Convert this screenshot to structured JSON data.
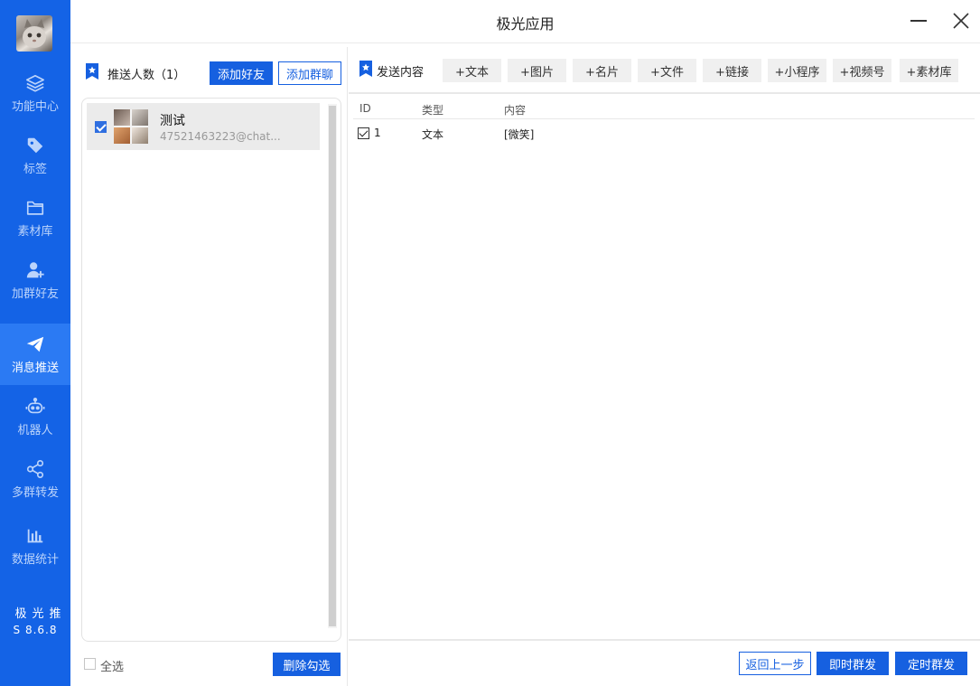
{
  "window": {
    "title": "极光应用"
  },
  "sidebar": {
    "items": [
      {
        "label": "功能中心",
        "icon": "layers-icon"
      },
      {
        "label": "标签",
        "icon": "tag-icon"
      },
      {
        "label": "素材库",
        "icon": "folder-icon"
      },
      {
        "label": "加群好友",
        "icon": "user-add-icon"
      },
      {
        "label": "消息推送",
        "icon": "send-icon",
        "active": true
      },
      {
        "label": "机器人",
        "icon": "robot-icon"
      },
      {
        "label": "多群转发",
        "icon": "share-icon"
      },
      {
        "label": "数据统计",
        "icon": "bar-chart-icon"
      }
    ],
    "brand_name": "极光推",
    "version": "S 8.6.8"
  },
  "left_panel": {
    "title": "推送人数（1）",
    "add_friend_button": "添加好友",
    "add_group_button": "添加群聊",
    "contacts": [
      {
        "name": "测试",
        "id": "47521463223@chat...",
        "checked": true
      }
    ],
    "select_all_label": "全选",
    "delete_selected_button": "删除勾选"
  },
  "right_panel": {
    "title": "发送内容",
    "add_buttons": [
      "+文本",
      "+图片",
      "+名片",
      "+文件",
      "+链接",
      "+小程序",
      "+视频号",
      "+素材库"
    ],
    "table": {
      "headers": [
        "ID",
        "类型",
        "内容"
      ],
      "rows": [
        {
          "id": "1",
          "type": "文本",
          "content": "[微笑]",
          "checked": true
        }
      ]
    },
    "back_button": "返回上一步",
    "send_now_button": "即时群发",
    "send_scheduled_button": "定时群发"
  },
  "colors": {
    "sidebar_bg": "#1463e6",
    "sidebar_active": "#2b7af3",
    "primary": "#1660e0"
  }
}
